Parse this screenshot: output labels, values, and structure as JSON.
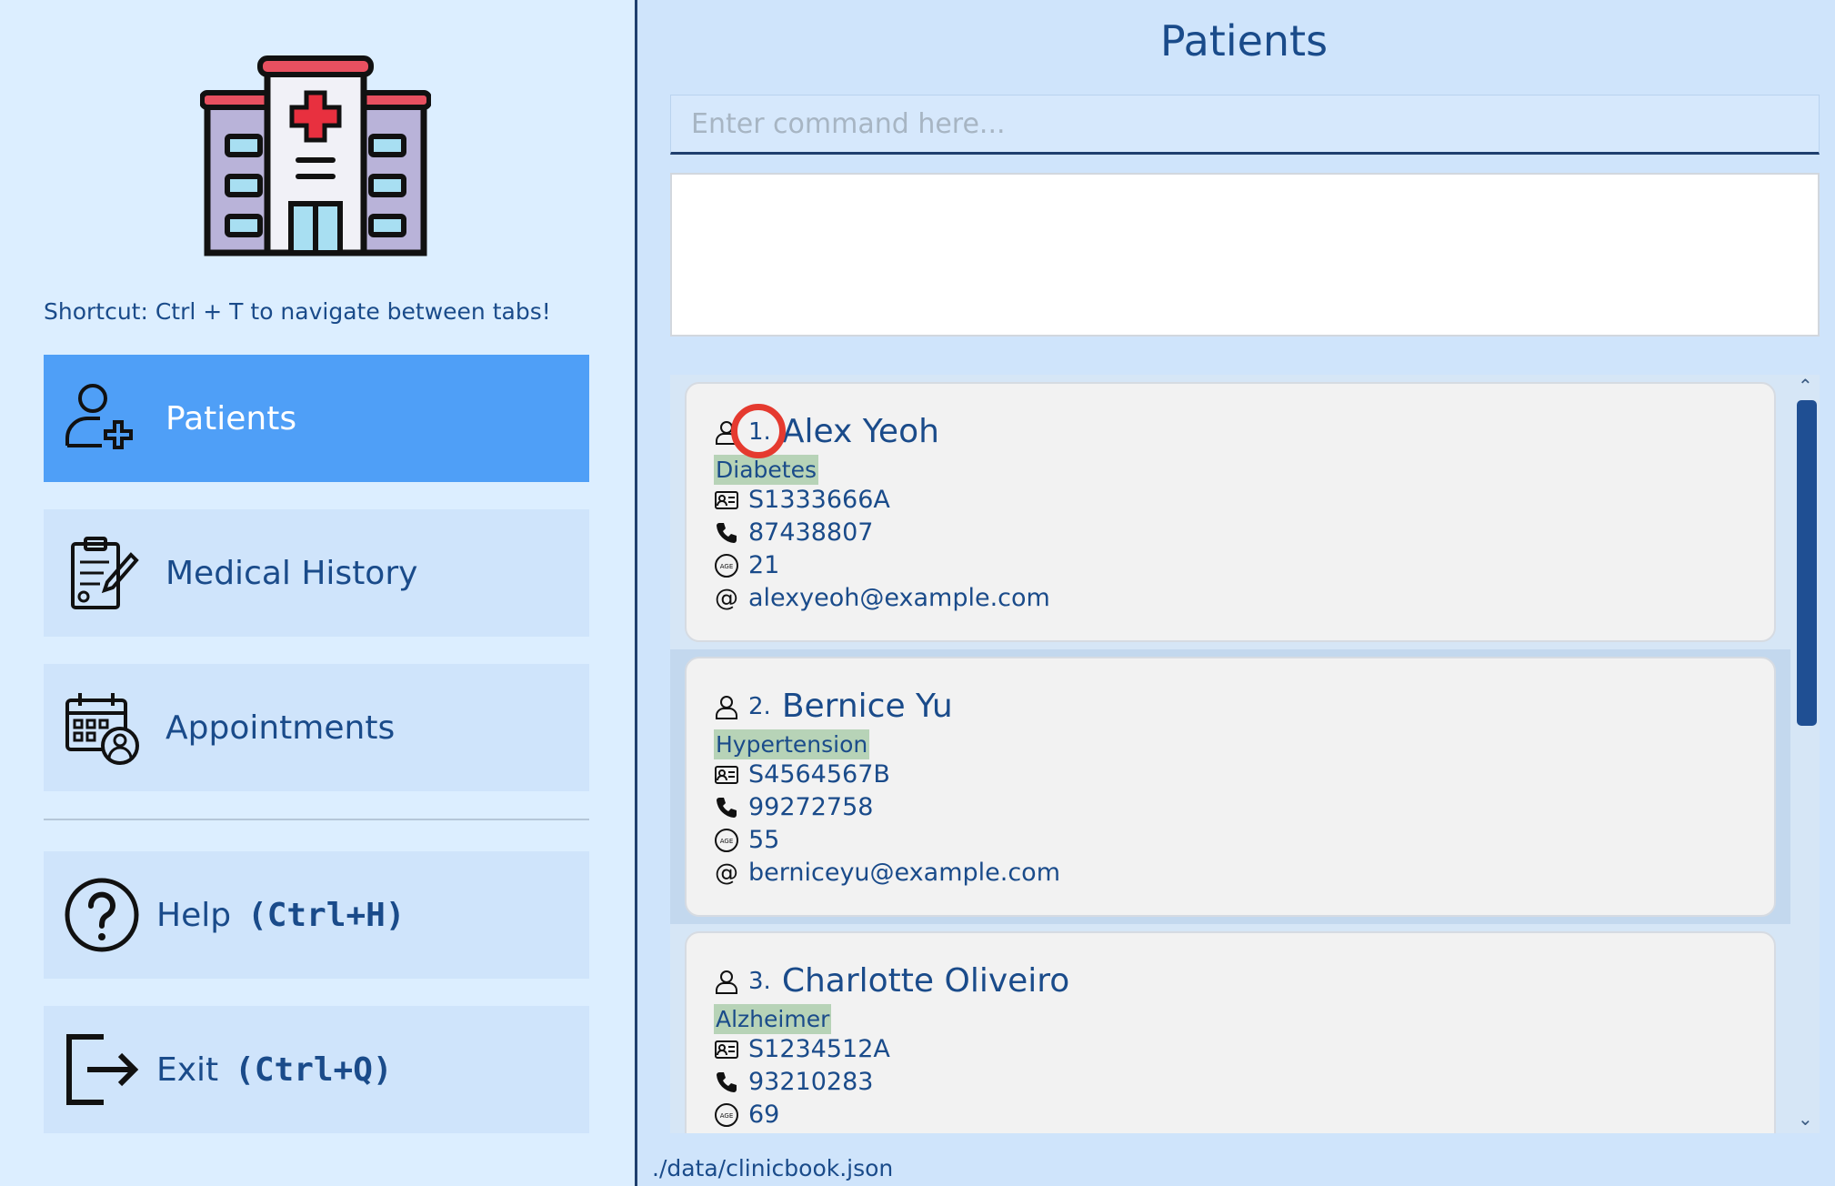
{
  "sidebar": {
    "shortcut_hint": "Shortcut: Ctrl + T to navigate between tabs!",
    "nav": [
      {
        "label": "Patients",
        "icon": "add-user-icon",
        "active": true
      },
      {
        "label": "Medical History",
        "icon": "clipboard-icon",
        "active": false
      },
      {
        "label": "Appointments",
        "icon": "calendar-icon",
        "active": false
      }
    ],
    "help": {
      "label": "Help",
      "shortcut": "(Ctrl+H)",
      "icon": "question-icon"
    },
    "exit": {
      "label": "Exit",
      "shortcut": "(Ctrl+Q)",
      "icon": "exit-icon"
    }
  },
  "main": {
    "title": "Patients",
    "command_placeholder": "Enter command here...",
    "result_text": "",
    "patients": [
      {
        "index": "1.",
        "name": "Alex Yeoh",
        "tag": "Diabetes",
        "nric": "S1333666A",
        "phone": "87438807",
        "age": "21",
        "email": "alexyeoh@example.com"
      },
      {
        "index": "2.",
        "name": "Bernice Yu",
        "tag": "Hypertension",
        "nric": "S4564567B",
        "phone": "99272758",
        "age": "55",
        "email": "berniceyu@example.com"
      },
      {
        "index": "3.",
        "name": "Charlotte Oliveiro",
        "tag": "Alzheimer",
        "nric": "S1234512A",
        "phone": "93210283",
        "age": "69",
        "email": ""
      }
    ]
  },
  "status_bar": {
    "path": "./data/clinicbook.json"
  },
  "colors": {
    "accent": "#4f9ff7",
    "sidebar_bg": "#dceeff",
    "main_bg": "#cfe4fb",
    "text": "#1a4b8a",
    "tag_bg": "#b7d3b7"
  }
}
